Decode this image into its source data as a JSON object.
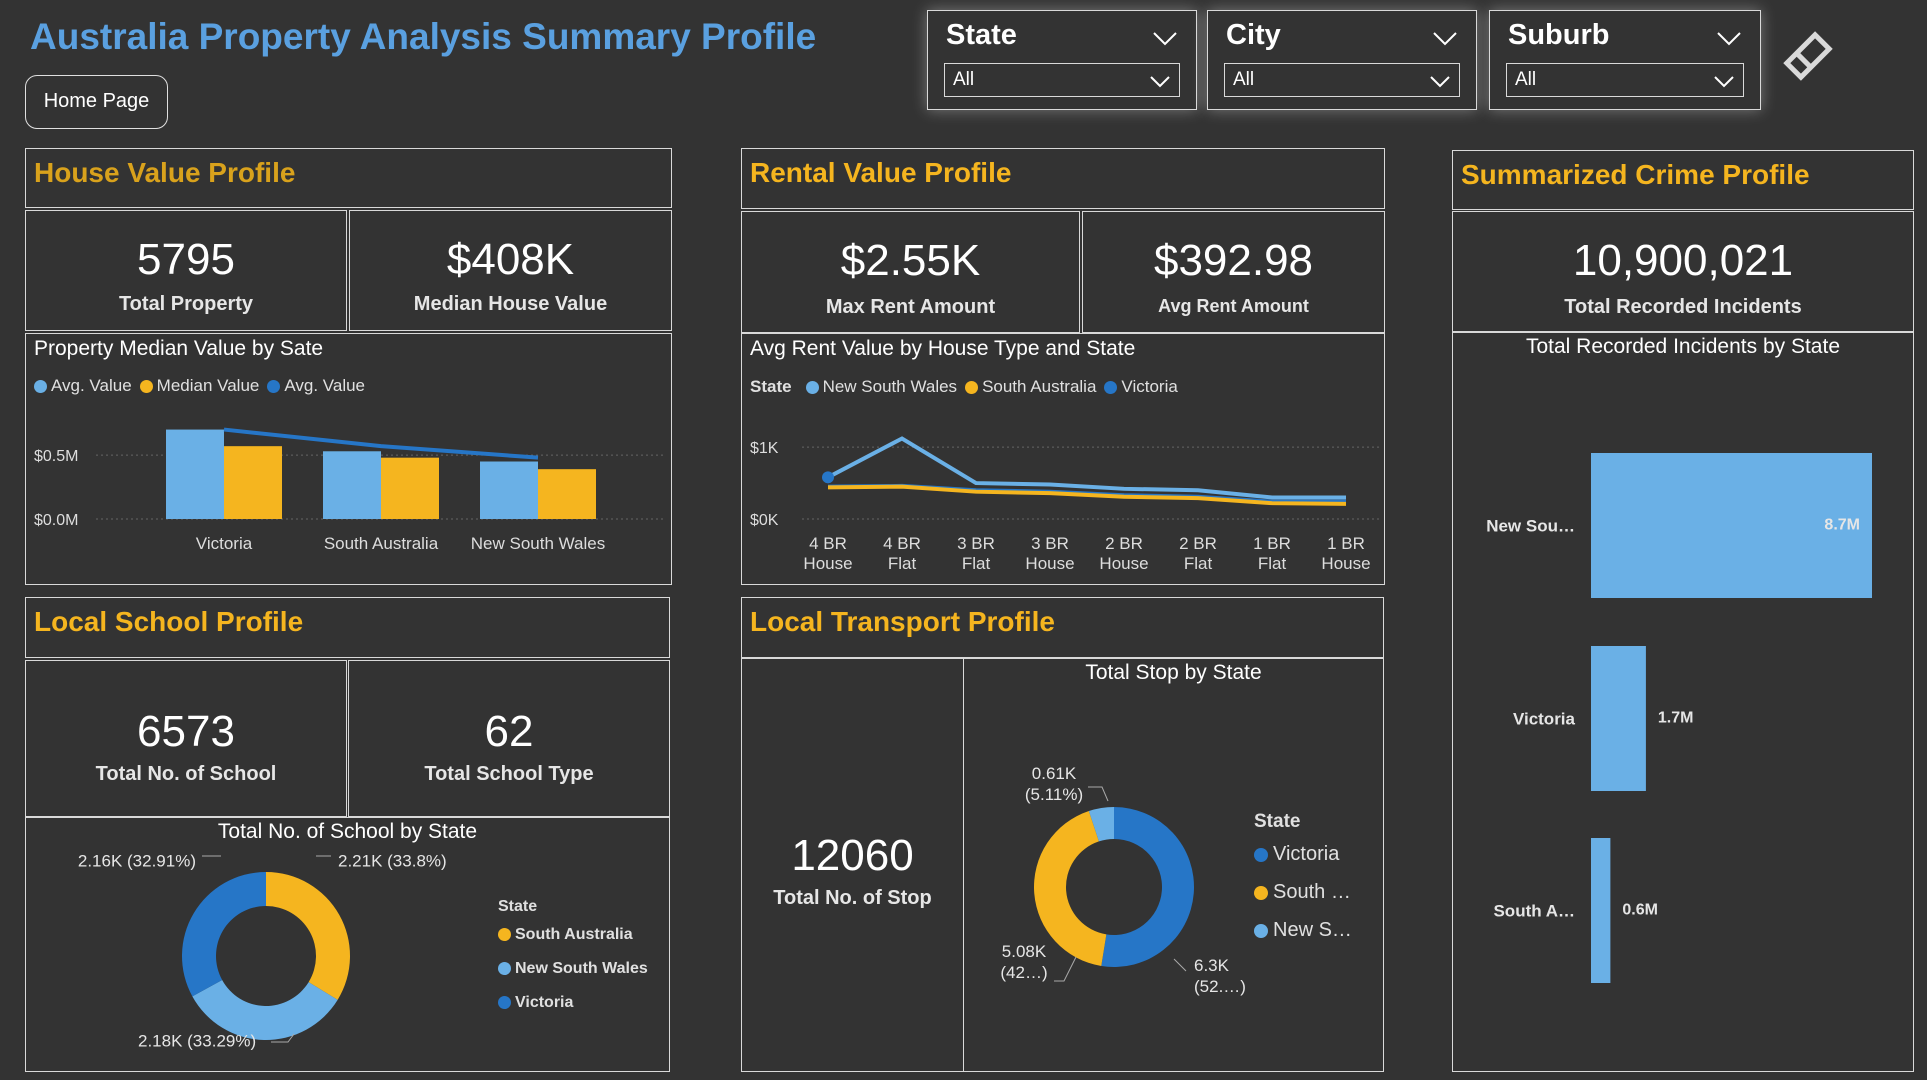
{
  "header": {
    "title": "Australia Property Analysis Summary Profile",
    "home_button": "Home Page"
  },
  "slicers": [
    {
      "label": "State",
      "value": "All"
    },
    {
      "label": "City",
      "value": "All"
    },
    {
      "label": "Suburb",
      "value": "All"
    }
  ],
  "colors": {
    "background": "#333333",
    "title_blue": "#5aa0e0",
    "accent_gold": "#f5b51f",
    "light_blue": "#6ab0e6",
    "dark_blue": "#2676c7"
  },
  "house": {
    "title": "House Value Profile",
    "kpi1_value": "5795",
    "kpi1_label": "Total Property",
    "kpi2_value": "$408K",
    "kpi2_label": "Median House Value",
    "chart_title": "Property Median Value by Sate",
    "legend": [
      "Avg. Value",
      "Median Value",
      "Avg. Value"
    ]
  },
  "rental": {
    "title": "Rental Value Profile",
    "kpi1_value": "$2.55K",
    "kpi1_label": "Max Rent Amount",
    "kpi2_value": "$392.98",
    "kpi2_label": "Avg Rent Amount",
    "chart_title": "Avg Rent Value by House Type and State",
    "legend_title": "State",
    "legend": [
      "New South Wales",
      "South Australia",
      "Victoria"
    ]
  },
  "crime": {
    "title": "Summarized Crime Profile",
    "kpi_value": "10,900,021",
    "kpi_label": "Total Recorded Incidents",
    "chart_title": "Total Recorded Incidents by State"
  },
  "school": {
    "title": "Local School Profile",
    "kpi1_value": "6573",
    "kpi1_label": "Total No. of School",
    "kpi2_value": "62",
    "kpi2_label": "Total School Type",
    "chart_title": "Total No. of School by State",
    "legend_title": "State",
    "legend": [
      "South Australia",
      "New South Wales",
      "Victoria"
    ]
  },
  "transport": {
    "title": "Local Transport Profile",
    "kpi_value": "12060",
    "kpi_label": "Total No. of Stop",
    "chart_title": "Total Stop by State",
    "legend_title": "State",
    "legend": [
      "Victoria",
      "South …",
      "New S…"
    ]
  },
  "chart_data": [
    {
      "id": "property_value",
      "type": "bar",
      "categories": [
        "Victoria",
        "South Australia",
        "New South Wales"
      ],
      "series": [
        {
          "name": "Avg. Value",
          "kind": "bar",
          "values": [
            0.7,
            0.53,
            0.45
          ]
        },
        {
          "name": "Median Value",
          "kind": "bar",
          "values": [
            0.57,
            0.48,
            0.39
          ]
        },
        {
          "name": "Avg. Value",
          "kind": "line",
          "values": [
            0.7,
            0.57,
            0.48
          ]
        }
      ],
      "yticks": [
        "$0.0M",
        "$0.5M"
      ],
      "ylim": [
        0,
        0.9
      ]
    },
    {
      "id": "rent_value",
      "type": "line",
      "categories": [
        "4 BR House",
        "4 BR Flat",
        "3 BR Flat",
        "3 BR House",
        "2 BR House",
        "2 BR Flat",
        "1 BR Flat",
        "1 BR House"
      ],
      "series": [
        {
          "name": "New South Wales",
          "values": [
            0.58,
            1.12,
            0.5,
            0.48,
            0.42,
            0.4,
            0.3,
            0.3
          ]
        },
        {
          "name": "South Australia",
          "values": [
            0.44,
            0.45,
            0.38,
            0.36,
            0.31,
            0.29,
            0.22,
            0.21
          ]
        },
        {
          "name": "Victoria",
          "values": [
            0.45,
            0.46,
            0.4,
            0.38,
            0.33,
            0.31,
            0.24,
            0.24
          ]
        }
      ],
      "yticks": [
        "$0K",
        "$1K"
      ],
      "ylim": [
        0,
        1.6
      ]
    },
    {
      "id": "crime_by_state",
      "type": "bar",
      "orientation": "vertical-categories",
      "categories": [
        "New Sou…",
        "Victoria",
        "South A…"
      ],
      "values": [
        8.7,
        1.7,
        0.6
      ],
      "labels": [
        "8.7M",
        "1.7M",
        "0.6M"
      ]
    },
    {
      "id": "school_by_state",
      "type": "pie",
      "categories": [
        "South Australia",
        "Victoria",
        "New South Wales"
      ],
      "values": [
        2.21,
        2.18,
        2.16
      ],
      "labels": [
        "2.21K (33.8%)",
        "2.18K (33.29%)",
        "2.16K (32.91%)"
      ]
    },
    {
      "id": "stop_by_state",
      "type": "pie",
      "categories": [
        "Victoria",
        "South Australia",
        "New South Wales"
      ],
      "values": [
        6.3,
        5.08,
        0.61
      ],
      "labels": [
        "6.3K (52.…)",
        "5.08K (42…)",
        "0.61K (5.11%)"
      ]
    }
  ]
}
